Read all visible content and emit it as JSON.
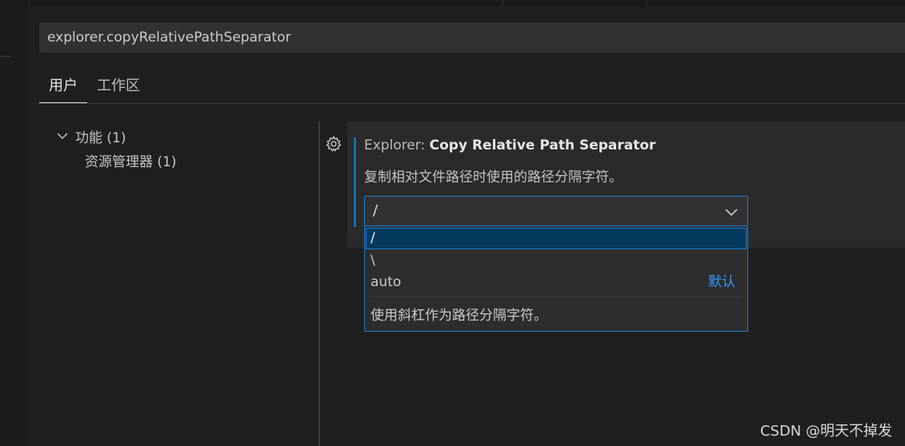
{
  "search": {
    "value": "explorer.copyRelativePathSeparator",
    "placeholder": ""
  },
  "tabs": [
    {
      "label": "用户",
      "active": true
    },
    {
      "label": "工作区",
      "active": false
    }
  ],
  "tree": {
    "group": {
      "label": "功能 (1)",
      "icon": "chevron-down-icon"
    },
    "child": {
      "label": "资源管理器 (1)"
    }
  },
  "setting": {
    "category": "Explorer: ",
    "name": "Copy Relative Path Separator",
    "description": "复制相对文件路径时使用的路径分隔字符。",
    "gear_icon": "gear-icon",
    "selected_value": "/",
    "options": [
      {
        "label": "/",
        "selected": true,
        "badge": ""
      },
      {
        "label": "\\",
        "selected": false,
        "badge": ""
      },
      {
        "label": "auto",
        "selected": false,
        "badge": "默认"
      }
    ],
    "option_description": "使用斜杠作为路径分隔字符。"
  },
  "watermark": "CSDN @明天不掉发",
  "colors": {
    "accent": "#1d7cd0",
    "selected_bg": "#04395e",
    "link": "#3794ff",
    "background": "#1f1f1f"
  }
}
